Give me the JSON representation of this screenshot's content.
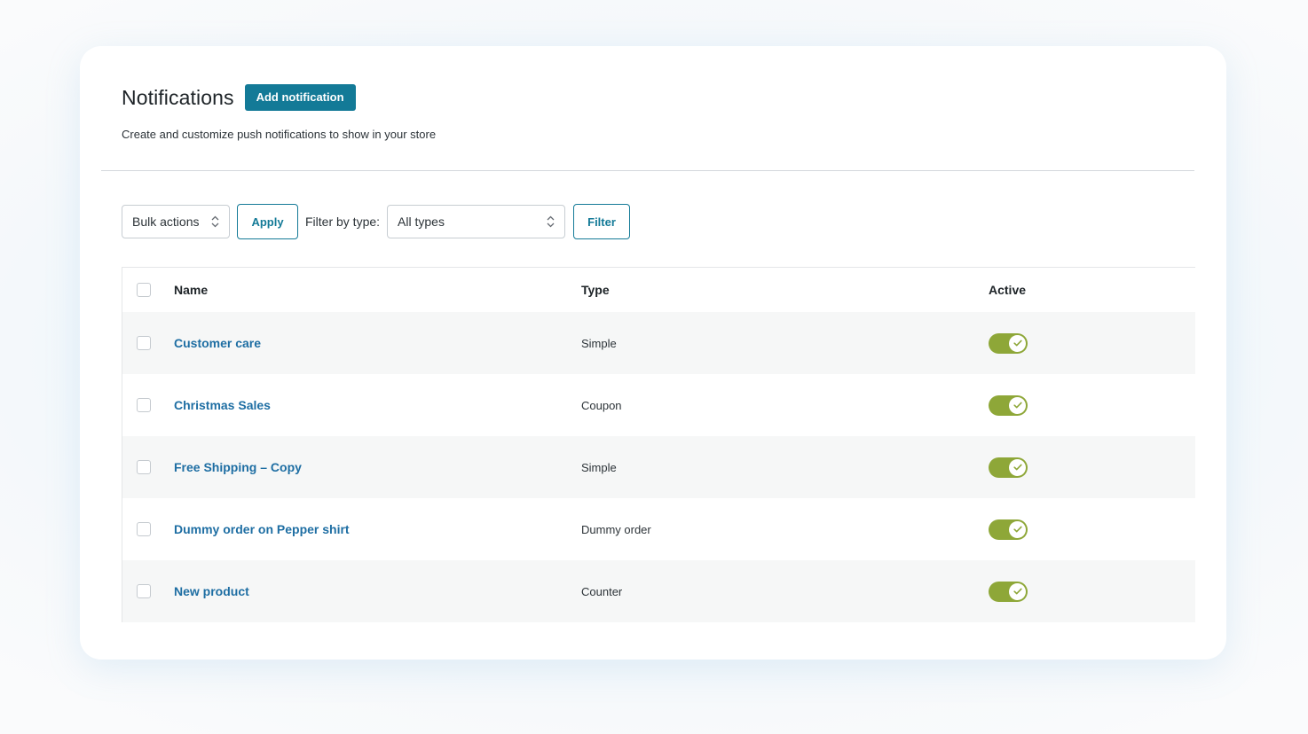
{
  "header": {
    "title": "Notifications",
    "add_button_label": "Add notification",
    "subtitle": "Create and customize push notifications to show in your store"
  },
  "toolbar": {
    "bulk_actions": "Bulk actions",
    "apply_label": "Apply",
    "filter_by_label": "Filter by type:",
    "type_filter_value": "All types",
    "filter_label": "Filter"
  },
  "table": {
    "columns": {
      "name": "Name",
      "type": "Type",
      "active": "Active"
    },
    "rows": [
      {
        "name": "Customer care",
        "type": "Simple",
        "active": true
      },
      {
        "name": "Christmas Sales",
        "type": "Coupon",
        "active": true
      },
      {
        "name": "Free Shipping – Copy",
        "type": "Simple",
        "active": true
      },
      {
        "name": "Dummy order on Pepper shirt",
        "type": "Dummy order",
        "active": true
      },
      {
        "name": "New product",
        "type": "Counter",
        "active": true
      }
    ]
  },
  "colors": {
    "primary": "#137a97",
    "link": "#1e6ea3",
    "toggle_on": "#8ea738"
  },
  "icons": {
    "select_arrows": "chevron-up-down-icon",
    "toggle_check": "check-icon"
  }
}
